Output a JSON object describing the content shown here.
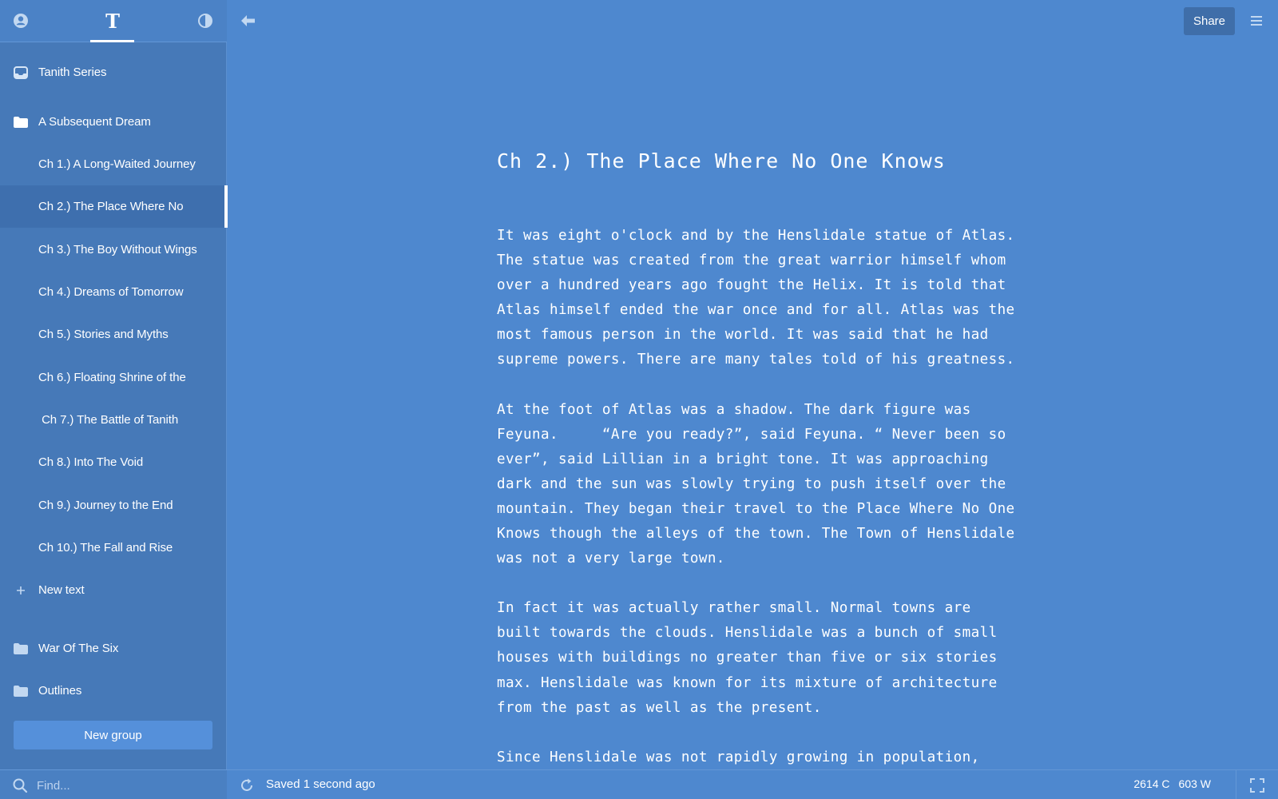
{
  "sidebar": {
    "top_icons": [
      "user-icon",
      "text-icon",
      "contrast-icon"
    ],
    "text_icon_glyph": "T",
    "items": [
      {
        "label": "Tanith Series",
        "icon": "inbox-icon"
      },
      {
        "label": "A Subsequent Dream",
        "icon": "folder-icon"
      },
      {
        "label": "Ch 1.) A Long-Waited Journey"
      },
      {
        "label": "Ch 2.) The Place Where No",
        "active": true
      },
      {
        "label": "Ch 3.) The Boy Without Wings"
      },
      {
        "label": "Ch 4.) Dreams of Tomorrow"
      },
      {
        "label": "Ch 5.) Stories and Myths"
      },
      {
        "label": "Ch 6.) Floating Shrine of the"
      },
      {
        "label": " Ch 7.) The Battle of Tanith"
      },
      {
        "label": "Ch 8.) Into The Void"
      },
      {
        "label": "Ch 9.) Journey to the End"
      },
      {
        "label": "Ch 10.) The Fall and Rise"
      },
      {
        "label": "New text",
        "icon": "plus-icon"
      },
      {
        "label": "War Of The Six",
        "icon": "folder-icon"
      },
      {
        "label": "Outlines",
        "icon": "folder-icon"
      }
    ],
    "new_group_label": "New group",
    "find_placeholder": "Find..."
  },
  "toolbar": {
    "share_label": "Share"
  },
  "document": {
    "title": "Ch 2.) The Place Where No One Knows",
    "paragraphs": [
      "It was eight o'clock and by the Henslidale statue of Atlas.\nThe statue was created from the great warrior himself whom\nover a hundred years ago fought the Helix. It is told that\nAtlas himself ended the war once and for all. Atlas was the\nmost famous person in the world. It was said that he had\nsupreme powers. There are many tales told of his greatness.",
      "At the foot of Atlas was a shadow. The dark figure was\nFeyuna.     “Are you ready?”, said Feyuna. “ Never been so\never”, said Lillian in a bright tone. It was approaching\ndark and the sun was slowly trying to push itself over the\nmountain. They began their travel to the Place Where No One\nKnows though the alleys of the town. The Town of Henslidale\nwas not a very large town.",
      "In fact it was actually rather small. Normal towns are\nbuilt towards the clouds. Henslidale was a bunch of small\nhouses with buildings no greater than five or six stories\nmax. Henslidale was known for its mixture of architecture\nfrom the past as well as the present.",
      "Since Henslidale was not rapidly growing in population,"
    ]
  },
  "status": {
    "saved_text": "Saved 1 second ago",
    "char_count": "2614 C",
    "word_count": "603 W"
  },
  "colors": {
    "background": "#4e88cf",
    "sidebar": "#4679b8",
    "active_item": "#3e6fae",
    "share_button": "#3f6ea9",
    "new_group_button": "#5590da"
  }
}
